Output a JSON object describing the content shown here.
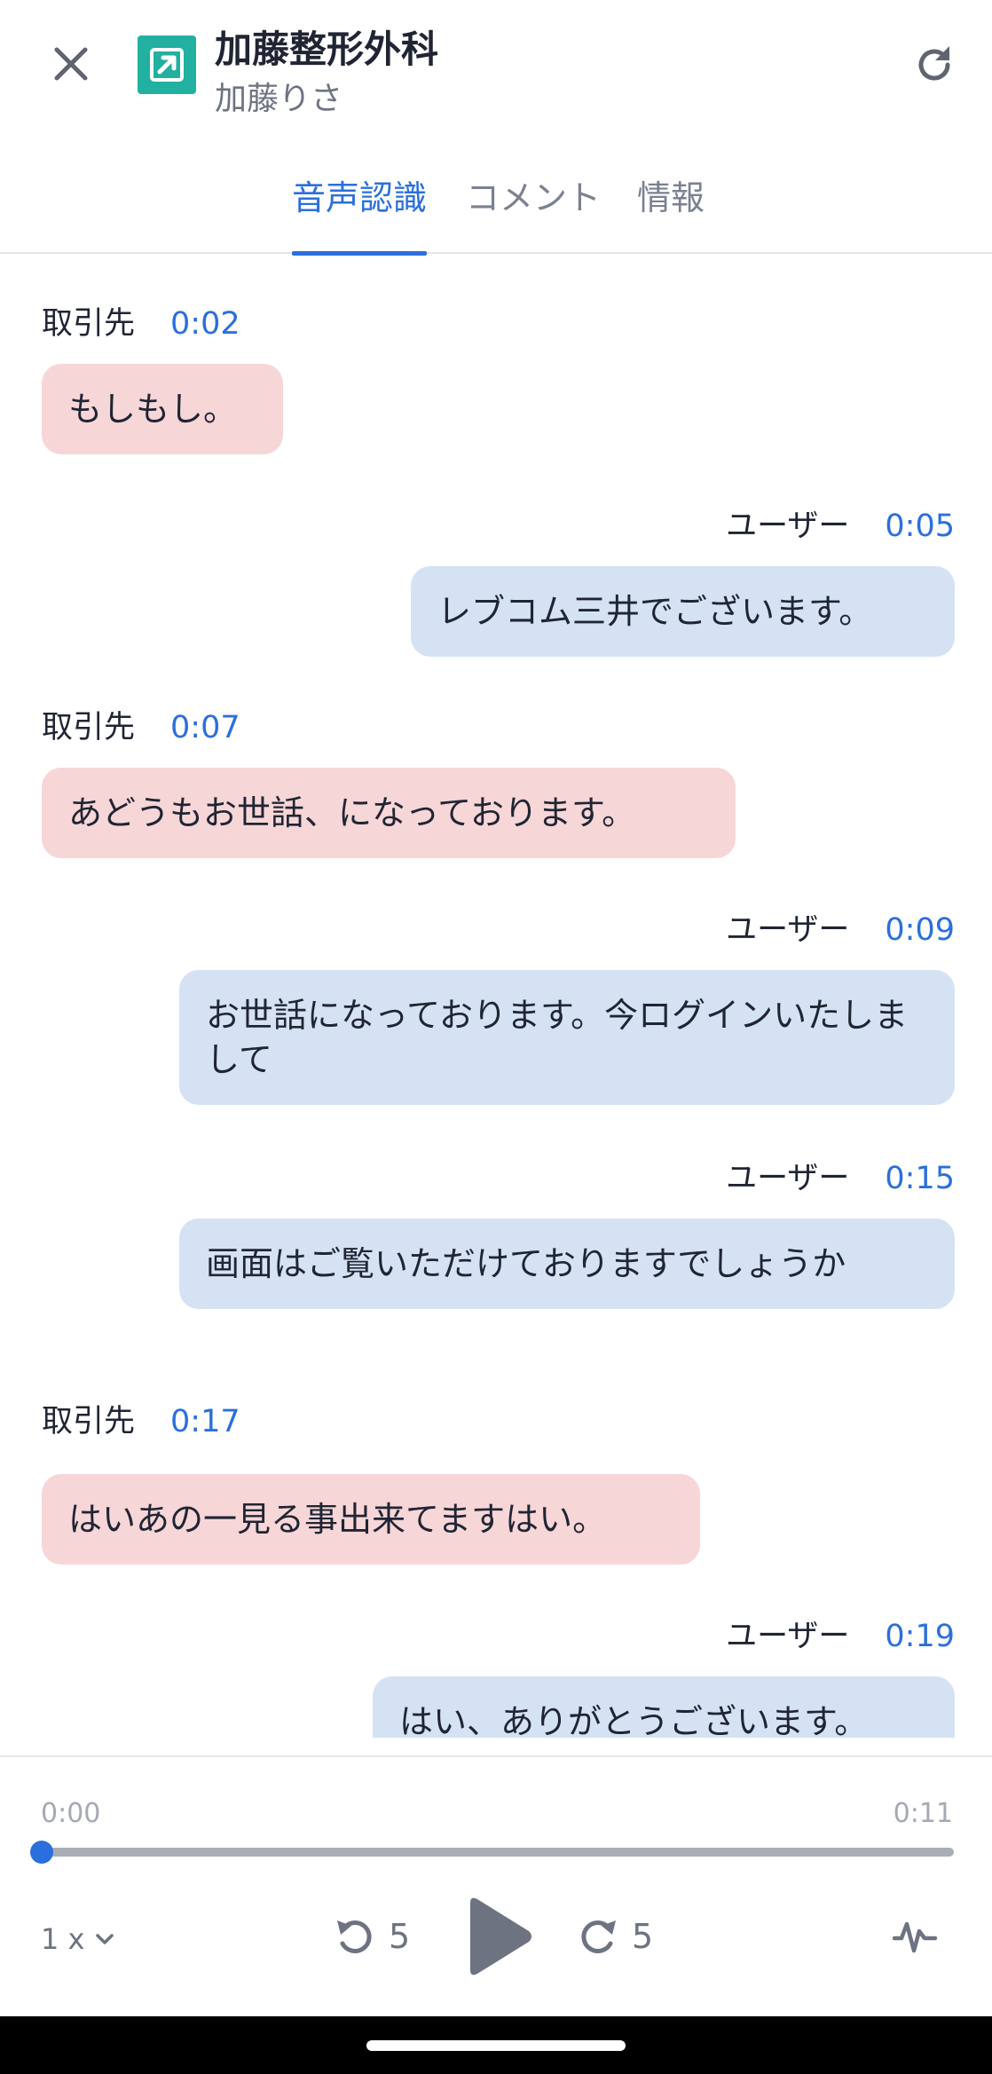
{
  "header": {
    "title": "加藤整形外科",
    "subtitle": "加藤りさ",
    "icons": {
      "close": "close-icon",
      "app": "external-link-icon",
      "refresh": "refresh-icon"
    },
    "accent_color": "#22b0a0"
  },
  "tabs": [
    {
      "label": "音声認識",
      "active": true
    },
    {
      "label": "コメント",
      "active": false
    },
    {
      "label": "情報",
      "active": false
    }
  ],
  "transcript": {
    "messages": [
      {
        "speaker": "取引先",
        "time": "0:02",
        "text": "もしもし。",
        "role": "client"
      },
      {
        "speaker": "ユーザー",
        "time": "0:05",
        "text": "レブコム三井でございます。",
        "role": "user"
      },
      {
        "speaker": "取引先",
        "time": "0:07",
        "text": "あどうもお世話、になっております。",
        "role": "client"
      },
      {
        "speaker": "ユーザー",
        "time": "0:09",
        "text": "お世話になっております。今ログインいたしまして",
        "role": "user"
      },
      {
        "speaker": "ユーザー",
        "time": "0:15",
        "text": "画面はご覧いただけておりますでしょうか",
        "role": "user"
      },
      {
        "speaker": "取引先",
        "time": "0:17",
        "text": "はいあの一見る事出来てますはい。",
        "role": "client"
      },
      {
        "speaker": "ユーザー",
        "time": "0:19",
        "text": "はい、ありがとうございます。",
        "role": "user"
      }
    ],
    "colors": {
      "client_bubble": "#f7d6d8",
      "user_bubble": "#d5e2f4",
      "time": "#2b6fdc"
    }
  },
  "player": {
    "current_time": "0:00",
    "total_time": "0:11",
    "progress": 0,
    "speed": "1 x",
    "rewind_seconds": "5",
    "forward_seconds": "5",
    "icons": {
      "speed": "chevron-down-icon",
      "rewind": "rewind-icon",
      "play": "play-icon",
      "forward": "forward-icon",
      "waveform": "waveform-icon"
    }
  }
}
